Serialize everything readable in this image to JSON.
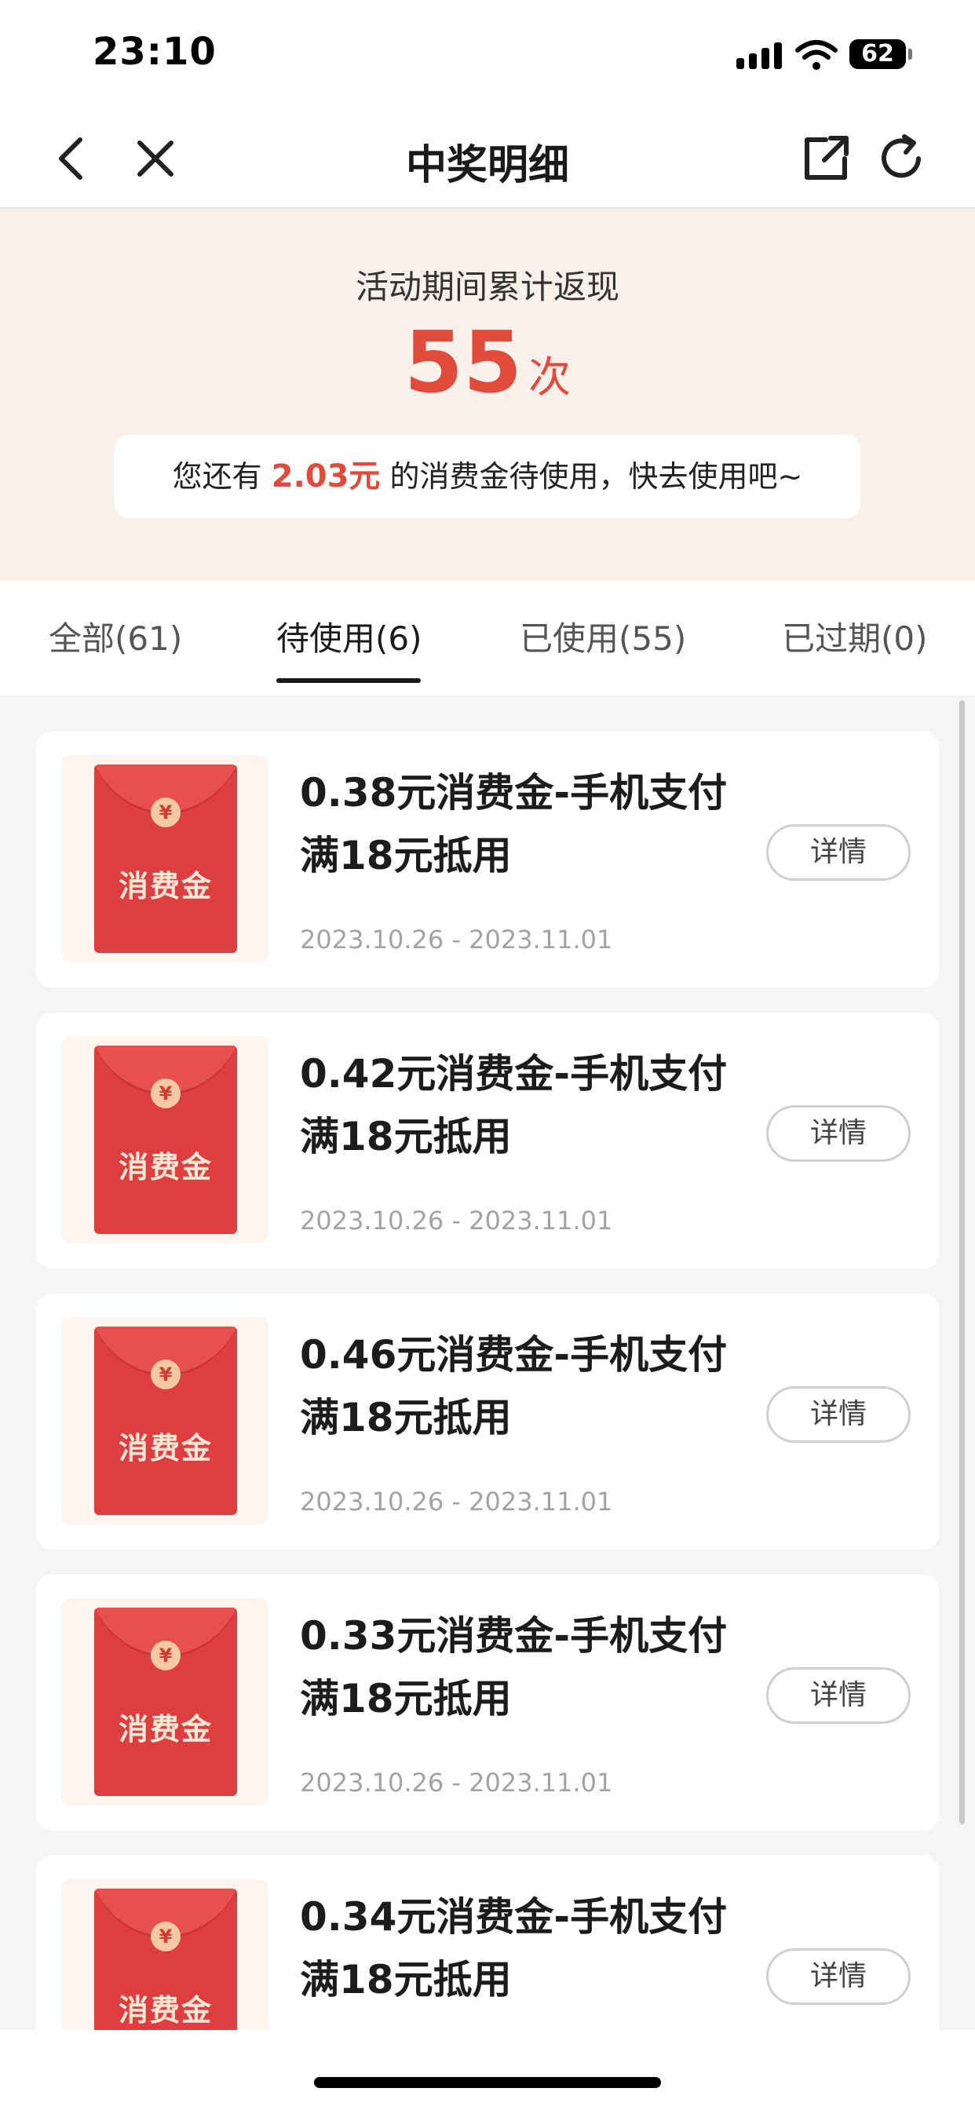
{
  "status_bar": {
    "time": "23:10",
    "battery": "62",
    "icons": [
      "signal-icon",
      "wifi-icon",
      "battery-icon"
    ]
  },
  "nav": {
    "title": "中奖明细",
    "icons": [
      "back-icon",
      "close-icon",
      "share-icon",
      "refresh-icon"
    ]
  },
  "summary": {
    "label": "活动期间累计返现",
    "count": "55",
    "unit": "次",
    "notice_prefix": "您还有 ",
    "notice_amount": "2.03元",
    "notice_suffix": " 的消费金待使用，快去使用吧~"
  },
  "tabs": [
    {
      "label": "全部(61)",
      "active": false
    },
    {
      "label": "待使用(6)",
      "active": true
    },
    {
      "label": "已使用(55)",
      "active": false
    },
    {
      "label": "已过期(0)",
      "active": false
    }
  ],
  "envelope": {
    "coin": "¥",
    "text": "消费金"
  },
  "items": [
    {
      "title_line1": "0.38元消费金-手机支付",
      "title_line2": "满18元抵用",
      "date": "2023.10.26 - 2023.11.01",
      "button": "详情"
    },
    {
      "title_line1": "0.42元消费金-手机支付",
      "title_line2": "满18元抵用",
      "date": "2023.10.26 - 2023.11.01",
      "button": "详情"
    },
    {
      "title_line1": "0.46元消费金-手机支付",
      "title_line2": "满18元抵用",
      "date": "2023.10.26 - 2023.11.01",
      "button": "详情"
    },
    {
      "title_line1": "0.33元消费金-手机支付",
      "title_line2": "满18元抵用",
      "date": "2023.10.26 - 2023.11.01",
      "button": "详情"
    },
    {
      "title_line1": "0.34元消费金-手机支付",
      "title_line2": "满18元抵用",
      "date": "",
      "button": "详情"
    }
  ],
  "colors": {
    "accent": "#e04b3c",
    "envelope": "#de3e3f",
    "summary_bg": "#f8f0ea"
  }
}
